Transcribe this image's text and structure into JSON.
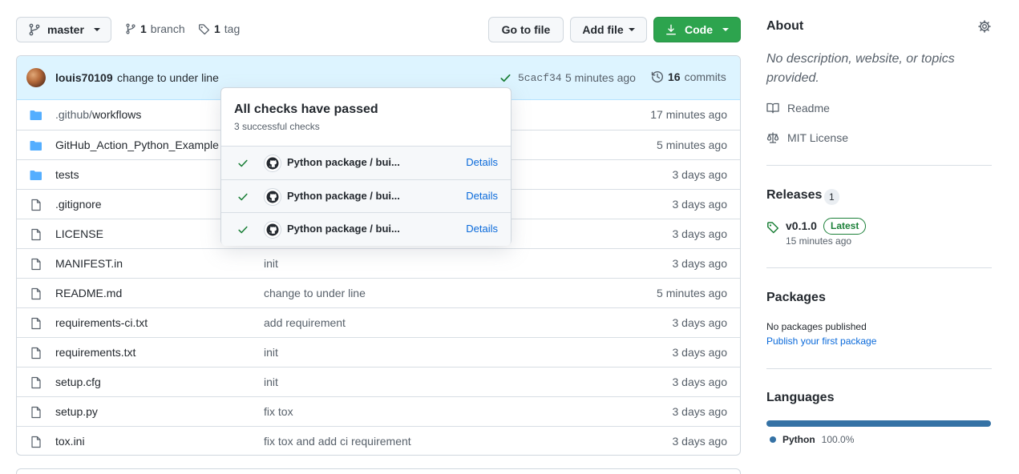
{
  "toolbar": {
    "branch_name": "master",
    "branch_count": "1",
    "branch_label": "branch",
    "tag_count": "1",
    "tag_label": "tag",
    "go_to_file": "Go to file",
    "add_file": "Add file",
    "code": "Code"
  },
  "commit": {
    "author": "louis70109",
    "message": "change to under line",
    "sha": "5cacf34",
    "time": "5 minutes ago",
    "commit_count": "16",
    "commits_label": "commits"
  },
  "files": [
    {
      "type": "dir",
      "prefix": ".github/",
      "name": "workflows",
      "message": "",
      "time": "17 minutes ago"
    },
    {
      "type": "dir",
      "prefix": "",
      "name": "GitHub_Action_Python_Example",
      "message": "",
      "time": "5 minutes ago"
    },
    {
      "type": "dir",
      "prefix": "",
      "name": "tests",
      "message": "",
      "time": "3 days ago"
    },
    {
      "type": "file",
      "prefix": "",
      "name": ".gitignore",
      "message": "",
      "time": "3 days ago"
    },
    {
      "type": "file",
      "prefix": "",
      "name": "LICENSE",
      "message": "",
      "time": "3 days ago"
    },
    {
      "type": "file",
      "prefix": "",
      "name": "MANIFEST.in",
      "message": "init",
      "time": "3 days ago"
    },
    {
      "type": "file",
      "prefix": "",
      "name": "README.md",
      "message": "change to under line",
      "time": "5 minutes ago"
    },
    {
      "type": "file",
      "prefix": "",
      "name": "requirements-ci.txt",
      "message": "add requirement",
      "time": "3 days ago"
    },
    {
      "type": "file",
      "prefix": "",
      "name": "requirements.txt",
      "message": "init",
      "time": "3 days ago"
    },
    {
      "type": "file",
      "prefix": "",
      "name": "setup.cfg",
      "message": "init",
      "time": "3 days ago"
    },
    {
      "type": "file",
      "prefix": "",
      "name": "setup.py",
      "message": "fix tox",
      "time": "3 days ago"
    },
    {
      "type": "file",
      "prefix": "",
      "name": "tox.ini",
      "message": "fix tox and add ci requirement",
      "time": "3 days ago"
    }
  ],
  "checks_popover": {
    "title": "All checks have passed",
    "subtitle": "3 successful checks",
    "checks": [
      {
        "name": "Python package / bui...",
        "details": "Details"
      },
      {
        "name": "Python package / bui...",
        "details": "Details"
      },
      {
        "name": "Python package / bui...",
        "details": "Details"
      }
    ]
  },
  "about": {
    "title": "About",
    "description": "No description, website, or topics provided.",
    "readme": "Readme",
    "license": "MIT License"
  },
  "releases": {
    "title": "Releases",
    "count": "1",
    "version": "v0.1.0",
    "latest_badge": "Latest",
    "time": "15 minutes ago"
  },
  "packages": {
    "title": "Packages",
    "none_text": "No packages published",
    "publish_link": "Publish your first package"
  },
  "languages": {
    "title": "Languages",
    "items": [
      {
        "name": "Python",
        "percent": "100.0%",
        "color": "#3572A5"
      }
    ]
  },
  "colors": {
    "primary_green": "#2da44e",
    "link_blue": "#0969da",
    "folder_blue": "#54aeff",
    "commit_bar_bg": "#ddf4ff"
  }
}
